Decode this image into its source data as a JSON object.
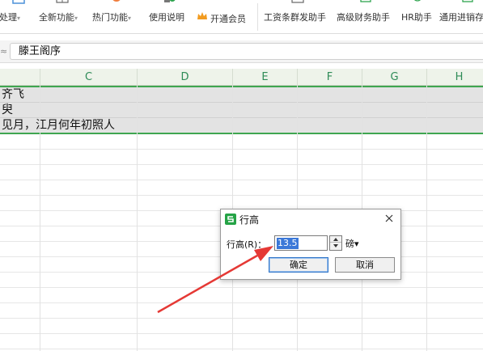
{
  "ribbon": {
    "items": [
      {
        "label": "处理",
        "caret": "▾"
      },
      {
        "label": "全新功能",
        "caret": "▾"
      },
      {
        "label": "热门功能",
        "caret": "▾"
      },
      {
        "label": "使用说明",
        "caret": ""
      },
      {
        "label": "开通会员",
        "caret": ""
      },
      {
        "label": "工资条群发助手",
        "caret": ""
      },
      {
        "label": "高级财务助手",
        "caret": ""
      },
      {
        "label": "HR助手",
        "caret": ""
      },
      {
        "label": "通用进销存",
        "caret": ""
      }
    ],
    "brand_color": "#f29b1f"
  },
  "formula_bar": {
    "value": "滕王阁序"
  },
  "sheet": {
    "columns": [
      "C",
      "D",
      "E",
      "F",
      "G",
      "H"
    ],
    "rows": [
      {
        "text": "齐飞"
      },
      {
        "text": "臾"
      },
      {
        "text": "见月，江月何年初照人"
      }
    ],
    "accent": "#3fa650"
  },
  "dialog": {
    "title": "行高",
    "row_height_label": "行高(R)：",
    "value": "13.5",
    "unit": "磅▾",
    "ok": "确定",
    "cancel": "取消"
  }
}
